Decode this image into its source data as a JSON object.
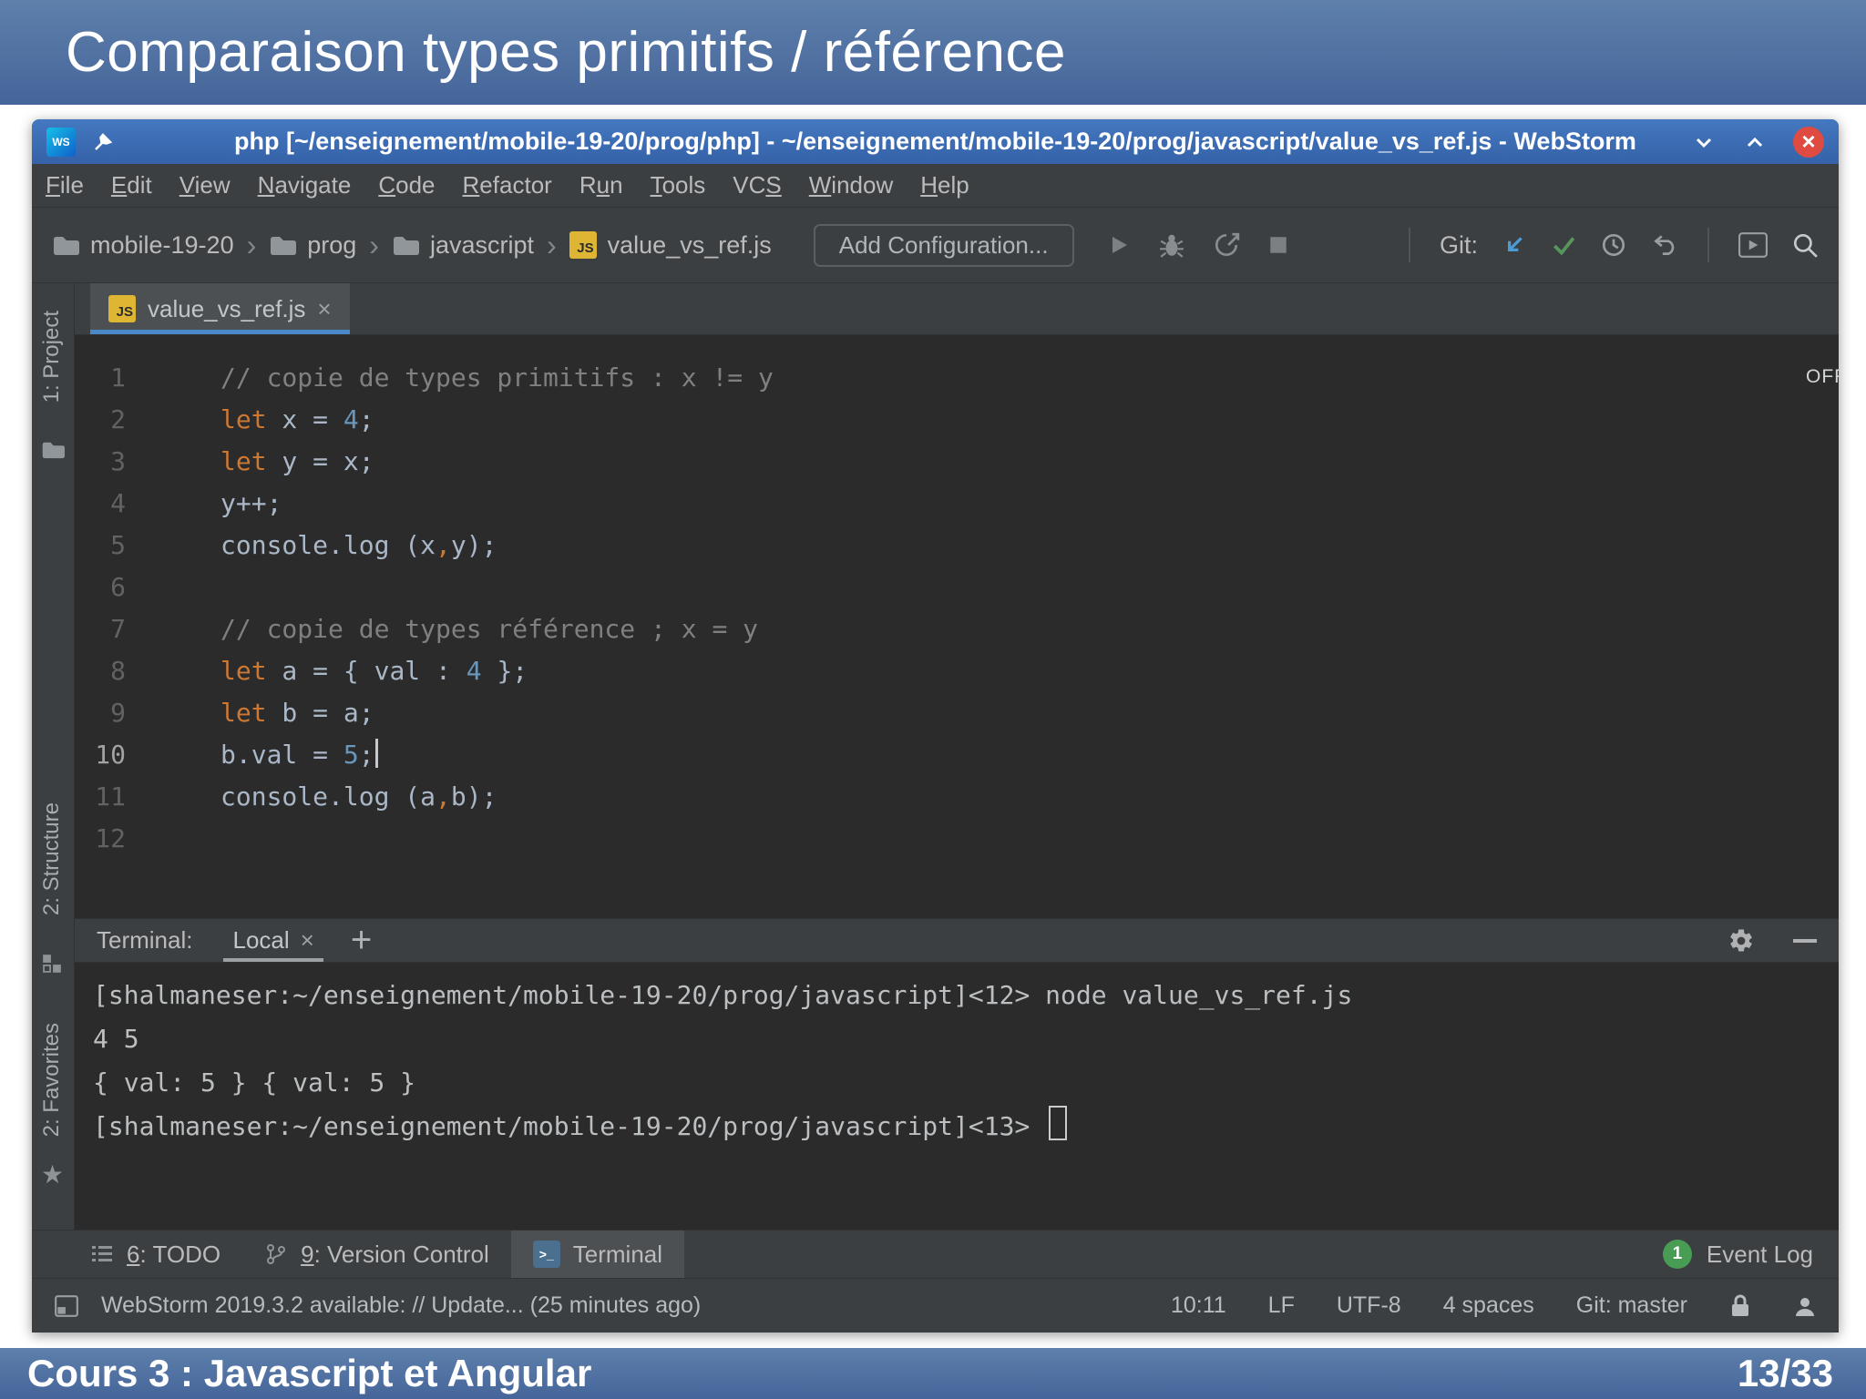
{
  "slide": {
    "title": "Comparaison types primitifs / référence",
    "footer_left": "Cours 3 : Javascript et Angular",
    "footer_right": "13/33"
  },
  "colors": {
    "slide_blue_top": "#5e80ab",
    "slide_blue_bottom": "#45659a",
    "titlebar_blue": "#3c6cb4",
    "panel_bg": "#3c3f41",
    "editor_bg": "#2b2b2b",
    "tab_underline": "#4a88c7",
    "keyword": "#cc7832",
    "number": "#6897bb",
    "comment": "#808080",
    "code_default": "#a9b7c6",
    "git_update_arrow": "#4b9cd6",
    "git_check_green": "#57965c",
    "event_log_green": "#499c54",
    "close_button_red": "#df4b41",
    "js_icon_yellow": "#deb633"
  },
  "icons": {
    "webstorm-logo": "WS square gradient",
    "pin-icon": "thumbtack",
    "minimize-icon": "chevron-down",
    "maximize-icon": "chevron-up",
    "close-icon": "× in red circle",
    "folder-icon": "folder shape",
    "js-file-icon": "JS yellow square",
    "run-icon": "play triangle (gray)",
    "debug-icon": "bug (gray)",
    "coverage-icon": "circle-arrow (gray)",
    "stop-icon": "square (gray)",
    "git-update-icon": "arrow down-left (blue)",
    "git-commit-icon": "check (green)",
    "history-icon": "clock",
    "rollback-icon": "undo arrow",
    "run-anything-icon": "window with play",
    "search-icon": "magnifier",
    "settings-gear-icon": "gear",
    "hide-panel-icon": "minus bar",
    "todo-icon": "numbered list",
    "version-control-icon": "branch",
    "terminal-icon": "prompt >_",
    "event-log-icon": "green circle with count",
    "lock-icon": "padlock",
    "user-icon": "person silhouette",
    "star-icon": "star"
  },
  "window": {
    "title": "php [~/enseignement/mobile-19-20/prog/php] - ~/enseignement/mobile-19-20/prog/javascript/value_vs_ref.js - WebStorm",
    "menu": [
      {
        "label": "File",
        "u": 0
      },
      {
        "label": "Edit",
        "u": 0
      },
      {
        "label": "View",
        "u": 0
      },
      {
        "label": "Navigate",
        "u": 0
      },
      {
        "label": "Code",
        "u": 0
      },
      {
        "label": "Refactor",
        "u": 0
      },
      {
        "label": "Run",
        "u": 1
      },
      {
        "label": "Tools",
        "u": 0
      },
      {
        "label": "VCS",
        "u": 2
      },
      {
        "label": "Window",
        "u": 0
      },
      {
        "label": "Help",
        "u": 0
      }
    ],
    "breadcrumbs": [
      {
        "label": "mobile-19-20",
        "icon": "folder"
      },
      {
        "label": "prog",
        "icon": "folder"
      },
      {
        "label": "javascript",
        "icon": "folder"
      },
      {
        "label": "value_vs_ref.js",
        "icon": "jsfile"
      }
    ],
    "add_configuration_label": "Add Configuration...",
    "git_label": "Git:"
  },
  "sidebar": {
    "project_label": "1: Project",
    "structure_label": "2: Structure",
    "favorites_label": "2: Favorites"
  },
  "editor": {
    "tab_label": "value_vs_ref.js",
    "js_badge": "JS",
    "off_label": "OFF",
    "lines": [
      {
        "n": "1",
        "tokens": [
          {
            "c": "com",
            "t": "// copie de types primitifs : x != y"
          }
        ]
      },
      {
        "n": "2",
        "tokens": [
          {
            "c": "kw",
            "t": "let"
          },
          {
            "c": "def",
            "t": " x = "
          },
          {
            "c": "num",
            "t": "4"
          },
          {
            "c": "def",
            "t": ";"
          }
        ]
      },
      {
        "n": "3",
        "tokens": [
          {
            "c": "kw",
            "t": "let"
          },
          {
            "c": "def",
            "t": " y = x;"
          }
        ]
      },
      {
        "n": "4",
        "tokens": [
          {
            "c": "def",
            "t": "y++;"
          }
        ]
      },
      {
        "n": "5",
        "tokens": [
          {
            "c": "def",
            "t": "console.log (x"
          },
          {
            "c": "kw",
            "t": ","
          },
          {
            "c": "def",
            "t": "y);"
          }
        ]
      },
      {
        "n": "6",
        "tokens": []
      },
      {
        "n": "7",
        "tokens": [
          {
            "c": "com",
            "t": "// copie de types référence ; x = y"
          }
        ]
      },
      {
        "n": "8",
        "tokens": [
          {
            "c": "kw",
            "t": "let"
          },
          {
            "c": "def",
            "t": " a = { val : "
          },
          {
            "c": "num",
            "t": "4"
          },
          {
            "c": "def",
            "t": " };"
          }
        ]
      },
      {
        "n": "9",
        "tokens": [
          {
            "c": "kw",
            "t": "let"
          },
          {
            "c": "def",
            "t": " b = a;"
          }
        ]
      },
      {
        "n": "10",
        "current": true,
        "tokens": [
          {
            "c": "def",
            "t": "b.val = "
          },
          {
            "c": "num",
            "t": "5"
          },
          {
            "c": "def",
            "t": ";"
          },
          {
            "c": "caret",
            "t": ""
          }
        ]
      },
      {
        "n": "11",
        "tokens": [
          {
            "c": "def",
            "t": "console.log (a"
          },
          {
            "c": "kw",
            "t": ","
          },
          {
            "c": "def",
            "t": "b);"
          }
        ]
      },
      {
        "n": "12",
        "tokens": []
      }
    ]
  },
  "terminal": {
    "panel_label": "Terminal:",
    "tab_label": "Local",
    "lines": [
      "[shalmaneser:~/enseignement/mobile-19-20/prog/javascript]<12> node value_vs_ref.js",
      "4 5",
      "{ val: 5 } { val: 5 }",
      "[shalmaneser:~/enseignement/mobile-19-20/prog/javascript]<13> "
    ],
    "cursor_on_last_line": true
  },
  "toolwindow_bar": {
    "todo": {
      "num": "6",
      "rest": ": TODO"
    },
    "version_control": {
      "num": "9",
      "rest": ": Version Control"
    },
    "terminal_label": "Terminal",
    "event_log_label": "Event Log",
    "event_log_count": "1"
  },
  "status_bar": {
    "message": "WebStorm 2019.3.2 available: // Update... (25 minutes ago)",
    "caret_position": "10:11",
    "line_separator": "LF",
    "encoding": "UTF-8",
    "indent": "4 spaces",
    "git_branch": "Git: master"
  }
}
